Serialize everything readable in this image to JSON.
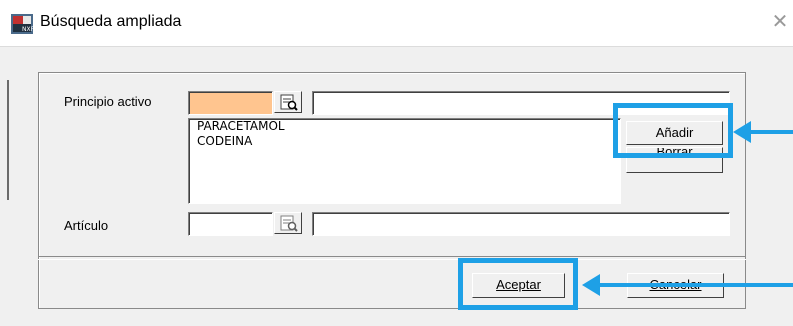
{
  "window": {
    "title": "Búsqueda ampliada",
    "close_glyph": "✕"
  },
  "form": {
    "principio_label": "Principio activo",
    "principio_code": "",
    "principio_name": "",
    "articulo_label": "Artículo",
    "articulo_code": "",
    "articulo_name": "",
    "list_items": [
      "PARACETAMOL",
      "CODEINA"
    ]
  },
  "buttons": {
    "add": "Añadir",
    "delete": "Borrar",
    "accept": "Aceptar",
    "cancel": "Cancelar"
  },
  "icons": {
    "search": "lookup-icon",
    "app": "app-icon"
  },
  "colors": {
    "highlight": "#1ea0e6",
    "required_field": "#ffc58f"
  }
}
